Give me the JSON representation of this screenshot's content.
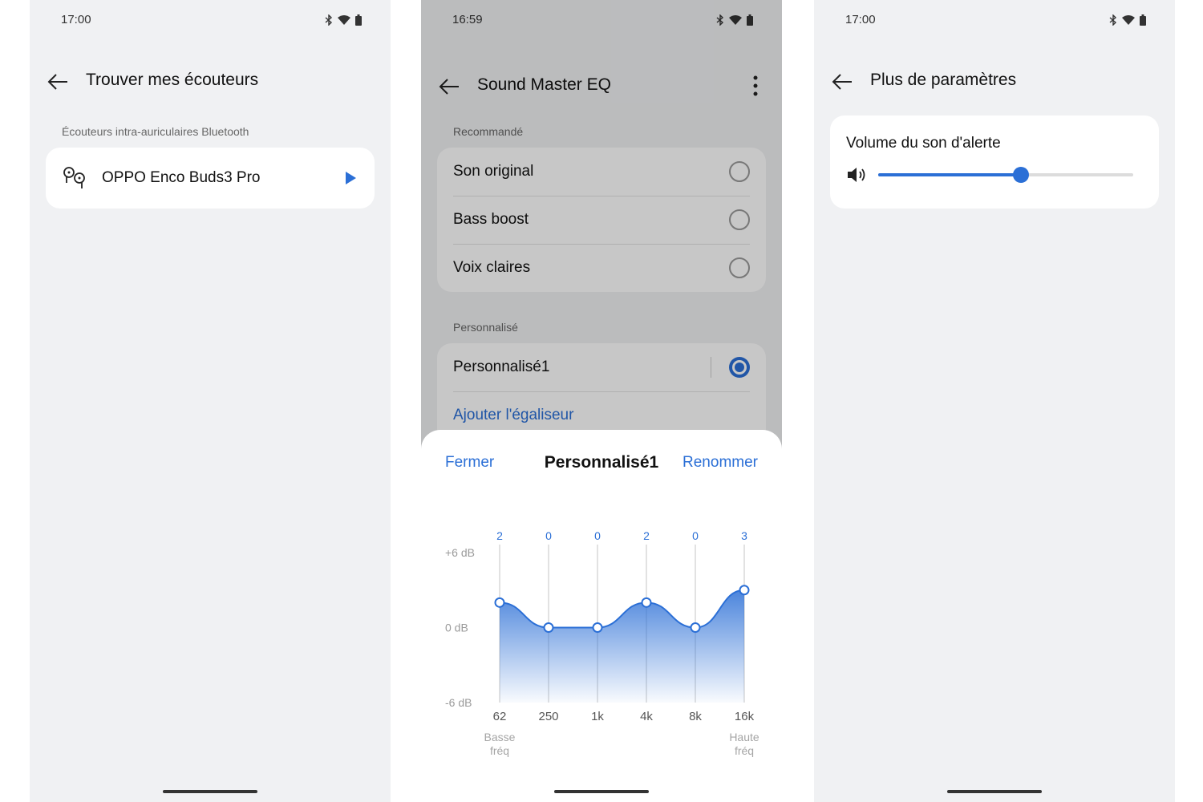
{
  "screen1": {
    "time": "17:00",
    "title": "Trouver mes écouteurs",
    "section_label": "Écouteurs intra-auriculaires Bluetooth",
    "device_name": "OPPO Enco Buds3 Pro"
  },
  "screen2": {
    "time": "16:59",
    "title": "Sound Master EQ",
    "recommended_label": "Recommandé",
    "recommended": [
      {
        "label": "Son original",
        "selected": false
      },
      {
        "label": "Bass boost",
        "selected": false
      },
      {
        "label": "Voix claires",
        "selected": false
      }
    ],
    "custom_label": "Personnalisé",
    "custom_item": {
      "label": "Personnalisé1",
      "selected": true
    },
    "add_eq_label": "Ajouter l'égaliseur",
    "sheet": {
      "close_label": "Fermer",
      "title": "Personnalisé1",
      "rename_label": "Renommer"
    }
  },
  "screen3": {
    "time": "17:00",
    "title": "Plus de paramètres",
    "volume_label": "Volume du son d'alerte",
    "volume_level": 0.56
  },
  "colors": {
    "accent": "#2b6fd6",
    "background": "#f0f1f3",
    "card": "#ffffff"
  },
  "chart_data": {
    "type": "line",
    "categories": [
      "62",
      "250",
      "1k",
      "4k",
      "8k",
      "16k"
    ],
    "values": [
      2,
      0,
      0,
      2,
      0,
      3
    ],
    "value_labels": [
      "2",
      "0",
      "0",
      "2",
      "0",
      "3"
    ],
    "y_tick_labels": [
      "+6 dB",
      "0 dB",
      "-6 dB"
    ],
    "ylim": [
      -6,
      6
    ],
    "low_label": [
      "Basse",
      "fréq"
    ],
    "high_label": [
      "Haute",
      "fréq"
    ],
    "fill": "gradient-area"
  }
}
